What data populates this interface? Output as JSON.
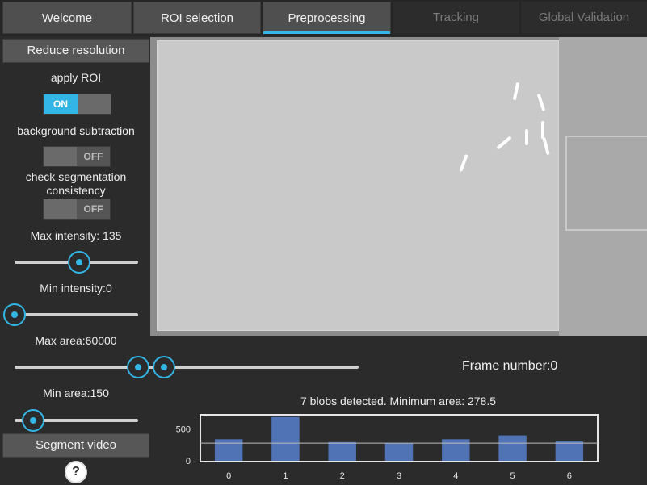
{
  "tabs": [
    {
      "label": "Welcome",
      "state": "enabled"
    },
    {
      "label": "ROI selection",
      "state": "enabled"
    },
    {
      "label": "Preprocessing",
      "state": "active"
    },
    {
      "label": "Tracking",
      "state": "disabled"
    },
    {
      "label": "Global Validation",
      "state": "disabled"
    }
  ],
  "left_panel": {
    "reduce_resolution_label": "Reduce resolution",
    "apply_roi_label": "apply ROI",
    "apply_roi_toggle": {
      "text": "ON",
      "on": true
    },
    "background_subtraction_label": "background subtraction",
    "background_subtraction_toggle": {
      "text": "OFF",
      "on": false
    },
    "check_segmentation_label": "check segmentation consistency",
    "check_segmentation_toggle": {
      "text": "OFF",
      "on": false
    },
    "max_intensity_label": "Max intensity: 135",
    "min_intensity_label": "Min intensity:0",
    "max_area_label": "Max area:60000",
    "min_area_label": "Min area:150",
    "segment_video_label": "Segment video",
    "help_label": "?"
  },
  "sliders": {
    "max_intensity": {
      "value": 135,
      "min": 0,
      "max": 255
    },
    "min_intensity": {
      "value": 0,
      "min": 0,
      "max": 255
    },
    "min_area": {
      "value": 150
    }
  },
  "frame": {
    "label": "Frame number:0"
  },
  "histogram": {
    "title": "7 blobs detected. Minimum area: 278.5"
  },
  "colors": {
    "accent": "#33b5e5",
    "bar": "#4f73b5",
    "panel_bg": "#2b2b2b"
  },
  "chart_data": {
    "type": "bar",
    "title": "7 blobs detected. Minimum area: 278.5",
    "categories": [
      "0",
      "1",
      "2",
      "3",
      "4",
      "5",
      "6"
    ],
    "values": [
      340,
      690,
      295,
      280,
      340,
      400,
      305
    ],
    "reference_line": 278.5,
    "ylim": [
      0,
      700
    ],
    "yticks": [
      0,
      500
    ],
    "xlabel": "",
    "ylabel": ""
  }
}
